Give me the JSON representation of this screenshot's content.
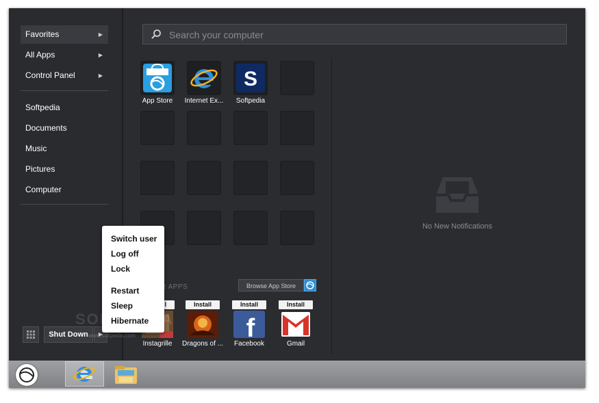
{
  "sidebar": {
    "top_items": [
      {
        "label": "Favorites"
      },
      {
        "label": "All Apps"
      },
      {
        "label": "Control Panel"
      }
    ],
    "places": [
      {
        "label": "Softpedia"
      },
      {
        "label": "Documents"
      },
      {
        "label": "Music"
      },
      {
        "label": "Pictures"
      },
      {
        "label": "Computer"
      }
    ],
    "arrow_glyph": "▶"
  },
  "search": {
    "placeholder": "Search your computer",
    "icon": "search-icon"
  },
  "favorites": [
    {
      "label": "App Store",
      "icon": "app-store-icon"
    },
    {
      "label": "Internet Ex...",
      "icon": "internet-explorer-icon"
    },
    {
      "label": "Softpedia",
      "icon": "softpedia-icon"
    }
  ],
  "notifications": {
    "text": "No New Notifications",
    "icon": "inbox-icon"
  },
  "popular": {
    "section_label": "AR APPS",
    "browse_label": "Browse App Store",
    "install_label": "Install",
    "apps": [
      {
        "label": "Instagrille"
      },
      {
        "label": "Dragons of ..."
      },
      {
        "label": "Facebook"
      },
      {
        "label": "Gmail"
      }
    ]
  },
  "shutdown": {
    "label": "Shut Down",
    "arrow_glyph": "▶"
  },
  "power_menu": {
    "items": [
      "Switch user",
      "Log off",
      "Lock",
      "Restart",
      "Sleep",
      "Hibernate"
    ]
  },
  "watermark": {
    "text": "SOFTPEDIA",
    "small": "www.softpedia.com"
  },
  "colors": {
    "accent": "#2b8fd8",
    "background": "#2b2c30"
  }
}
